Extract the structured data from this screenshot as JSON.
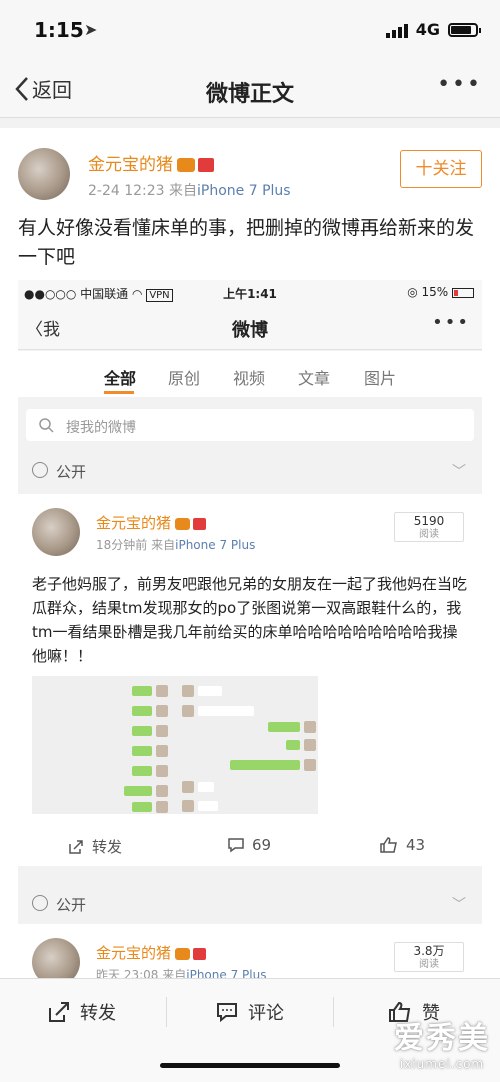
{
  "status_bar": {
    "time": "1:15",
    "network": "4G"
  },
  "nav": {
    "back_label": "返回",
    "title": "微博正文"
  },
  "post": {
    "author": "金元宝的猪",
    "date": "2-24 12:23",
    "source_prefix": "来自",
    "source": "iPhone 7 Plus",
    "follow_label": "十关注",
    "text": "有人好像没看懂床单的事，把删掉的微博再给新来的发一下吧"
  },
  "screenshot": {
    "status": {
      "carrier": "●●○○○ 中国联通",
      "vpn": "VPN",
      "time": "上午1:41",
      "battery": "15%"
    },
    "nav": {
      "back_label": "我",
      "title": "微博"
    },
    "tabs": [
      "全部",
      "原创",
      "视频",
      "文章",
      "图片"
    ],
    "search_placeholder": "搜我的微博",
    "visibility_label": "公开",
    "card": {
      "author": "金元宝的猪",
      "time": "18分钟前",
      "source_prefix": "来自",
      "source": "iPhone 7 Plus",
      "reads_value": "5190",
      "reads_label": "阅读",
      "text": "老子他妈服了，前男友吧跟他兄弟的女朋友在一起了我他妈在当吃瓜群众，结果tm发现那女的po了张图说第一双高跟鞋什么的，我tm一看结果卧槽是我几年前给买的床单哈哈哈哈哈哈哈哈哈我操他嘛！！",
      "actions": {
        "repost": "转发",
        "comments": "69",
        "likes": "43"
      }
    },
    "card2": {
      "author": "金元宝的猪",
      "time": "昨天 23:08",
      "source_prefix": "来自",
      "source": "iPhone 7 Plus",
      "reads_value": "3.8万",
      "reads_label": "阅读"
    }
  },
  "bottom_bar": {
    "repost": "转发",
    "comment": "评论",
    "like": "赞"
  },
  "watermark": {
    "title": "爱秀美",
    "url": "ixiumei.com"
  },
  "colors": {
    "accent": "#f08a2a",
    "name": "#e8891b",
    "link": "#5b7fae"
  }
}
